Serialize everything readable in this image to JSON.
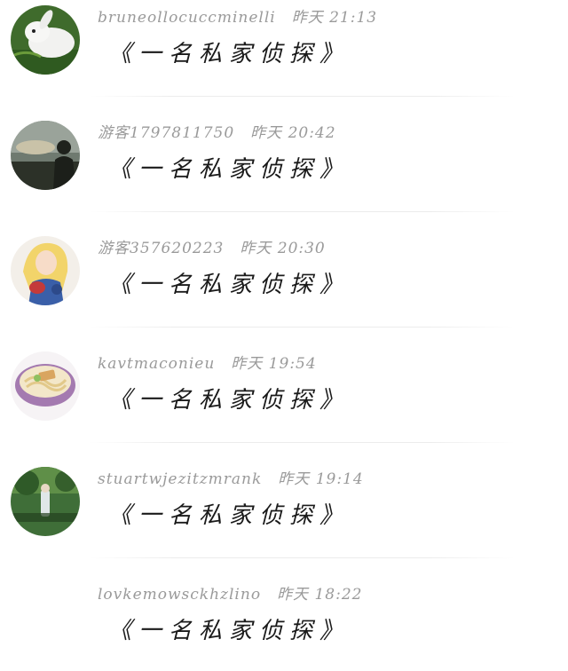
{
  "comments": [
    {
      "username": "bruneollocuccminelli",
      "time": "昨天 21:13",
      "text": "《一名私家侦探》",
      "avatar_icon": "rabbit-avatar-icon"
    },
    {
      "username": "游客1797811750",
      "time": "昨天 20:42",
      "text": "《一名私家侦探》",
      "avatar_icon": "dusk-silhouette-avatar-icon"
    },
    {
      "username": "游客357620223",
      "time": "昨天 20:30",
      "text": "《一名私家侦探》",
      "avatar_icon": "anime-girl-avatar-icon"
    },
    {
      "username": "kavtmaconieu",
      "time": "昨天 19:54",
      "text": "《一名私家侦探》",
      "avatar_icon": "noodle-bowl-avatar-icon"
    },
    {
      "username": "stuartwjezitzmrank",
      "time": "昨天 19:14",
      "text": "《一名私家侦探》",
      "avatar_icon": "green-scene-avatar-icon"
    },
    {
      "username": "lovkemowsckhzlino",
      "time": "昨天 18:22",
      "text": "《一名私家侦探》",
      "avatar_icon": ""
    }
  ]
}
